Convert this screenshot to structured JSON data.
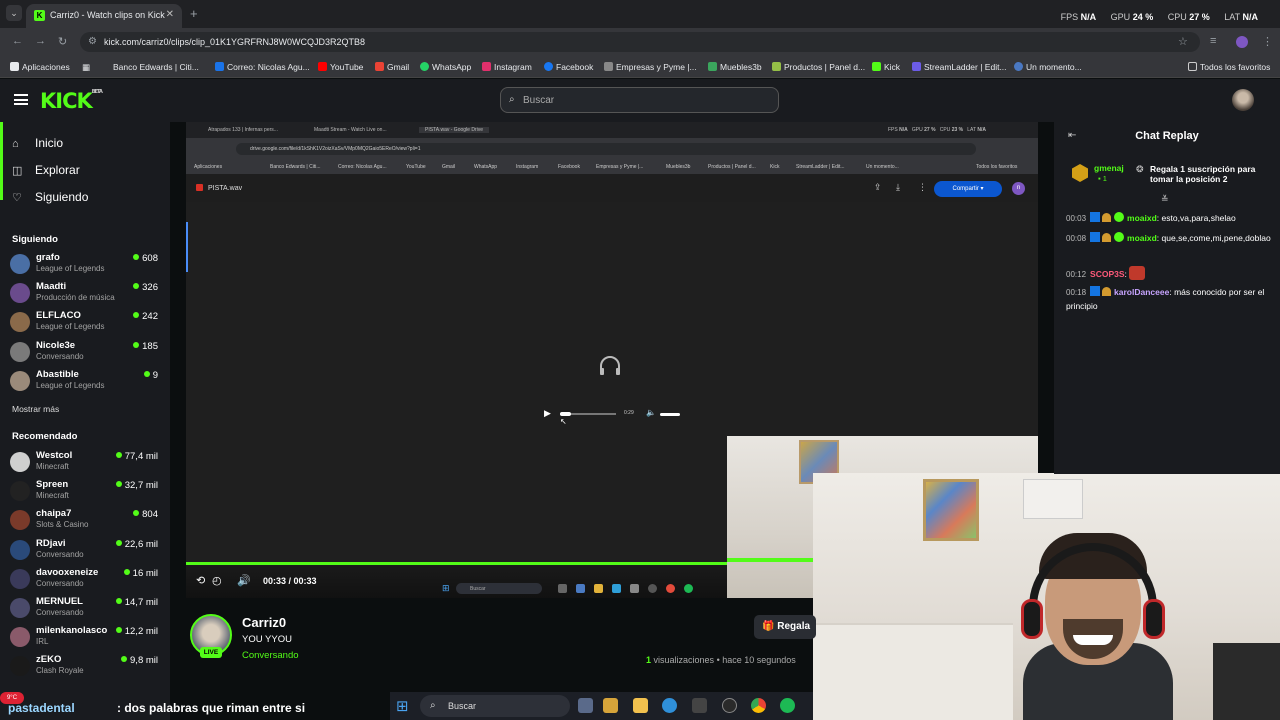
{
  "browser": {
    "tab_title": "Carriz0 - Watch clips on Kick",
    "url": "kick.com/carriz0/clips/clip_01K1YGRFRNJ8W0WCQJD3R2QTB8",
    "perf": {
      "fps_label": "FPS",
      "fps": "N/A",
      "gpu_label": "GPU",
      "gpu": "24 %",
      "cpu_label": "CPU",
      "cpu": "27 %",
      "lat_label": "LAT",
      "lat": "N/A"
    },
    "bookmarks": [
      "Aplicaciones",
      "Banco Edwards | Citi...",
      "Correo: Nicolas Agu...",
      "YouTube",
      "Gmail",
      "WhatsApp",
      "Instagram",
      "Facebook",
      "Empresas y Pyme |...",
      "Muebles3b",
      "Productos | Panel d...",
      "Kick",
      "StreamLadder | Edit...",
      "Un momento..."
    ],
    "all_bookmarks": "Todos los favoritos"
  },
  "header": {
    "logo": "KICK",
    "logo_beta": "BETA",
    "search_placeholder": "Buscar"
  },
  "sidebar": {
    "nav": [
      {
        "label": "Inicio",
        "icon": "home-icon"
      },
      {
        "label": "Explorar",
        "icon": "compass-icon"
      },
      {
        "label": "Siguiendo",
        "icon": "heart-icon"
      }
    ],
    "following_title": "Siguiendo",
    "following": [
      {
        "name": "grafo",
        "category": "League of Legends",
        "viewers": "608",
        "color": "#4a6fa5"
      },
      {
        "name": "Maadti",
        "category": "Producción de música",
        "viewers": "326",
        "color": "#6a4b8c"
      },
      {
        "name": "ELFLACO",
        "category": "League of Legends",
        "viewers": "242",
        "color": "#8a6a4a"
      },
      {
        "name": "Nicole3e",
        "category": "Conversando",
        "viewers": "185",
        "color": "#7a7a7a"
      },
      {
        "name": "Abastible",
        "category": "League of Legends",
        "viewers": "9",
        "color": "#9a8a7a"
      }
    ],
    "show_more": "Mostrar más",
    "recommended_title": "Recomendado",
    "recommended": [
      {
        "name": "Westcol",
        "category": "Minecraft",
        "viewers": "77,4 mil",
        "color": "#cfcfcf"
      },
      {
        "name": "Spreen",
        "category": "Minecraft",
        "viewers": "32,7 mil",
        "color": "#222222"
      },
      {
        "name": "chaipa7",
        "category": "Slots & Casino",
        "viewers": "804",
        "color": "#7a3a2a"
      },
      {
        "name": "RDjavi",
        "category": "Conversando",
        "viewers": "22,6 mil",
        "color": "#2a4a7a"
      },
      {
        "name": "davooxeneize",
        "category": "Conversando",
        "viewers": "16 mil",
        "color": "#3a3a5a"
      },
      {
        "name": "MERNUEL",
        "category": "Conversando",
        "viewers": "14,7 mil",
        "color": "#4a4a6a"
      },
      {
        "name": "milenkanolasco",
        "category": "IRL",
        "viewers": "12,2 mil",
        "color": "#8a5a6a"
      },
      {
        "name": "zEKO",
        "category": "Clash Royale",
        "viewers": "9,8 mil",
        "color": "#1a1a1a"
      }
    ]
  },
  "video": {
    "inner_tabs": [
      "Atrapados 133 | Infernas pers...",
      "Maadti Stream - Watch Live on...",
      "PISTA.wav - Google Drive"
    ],
    "inner_url": "drive.google.com/file/d/1kShK1V2oizXaSv/VMp0MQ2Gaio5EReO/view?pli=1",
    "file_name": "PISTA.wav",
    "share_label": "Compartir",
    "audio_time": "0:29",
    "audio_progress": 0.2,
    "time_current": "00:33",
    "time_total": "00:33",
    "progress": 1.0,
    "inner_search": "Buscar"
  },
  "stream": {
    "name": "Carriz0",
    "title": "YOU YYOU",
    "category": "Conversando",
    "live": "LIVE",
    "views_count": "1",
    "views_label": "visualizaciones",
    "time_ago": "• hace 10 segundos",
    "gift_button": "Regala"
  },
  "chat": {
    "title": "Chat Replay",
    "gift": {
      "user": "gmenaj",
      "count": "1",
      "message": "Regala 1 suscripción para tomar la posición 2"
    },
    "messages": [
      {
        "time": "00:03",
        "user": "moaixd",
        "text": "esto,va,para,shelao",
        "color": "#53fc18"
      },
      {
        "time": "00:08",
        "user": "moaixd",
        "text": "que,se,come,mi,pene,doblao",
        "color": "#53fc18"
      },
      {
        "time": "00:12",
        "user": "SCOP3S",
        "text": "",
        "color": "#ff5a7a"
      },
      {
        "time": "00:18",
        "user": "karolDanceee",
        "text": "más conocido por ser el principio",
        "color": "#c7a4ff"
      }
    ]
  },
  "overlay": {
    "user": "pastadental",
    "message": ": dos palabras que riman entre si"
  },
  "taskbar": {
    "search": "Buscar"
  }
}
